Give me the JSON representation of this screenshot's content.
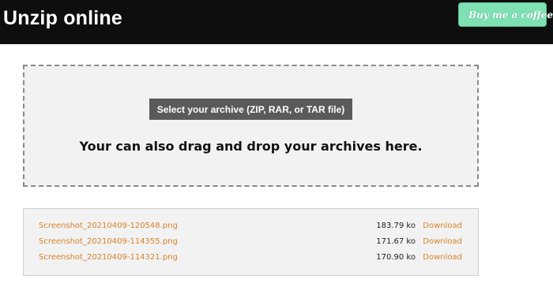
{
  "header": {
    "title": "Unzip online",
    "coffee_button": {
      "label": "Buy me a coffee",
      "icon": "coffee-cup-icon",
      "color": "#7ee0b3"
    }
  },
  "dropzone": {
    "select_button_label": "Select your archive (ZIP, RAR, or TAR file)",
    "hint": "Your can also drag and drop your archives here."
  },
  "files": [
    {
      "name": "Screenshot_20210409-120548.png",
      "size": "183.79 ko",
      "action": "Download"
    },
    {
      "name": "Screenshot_20210409-114355.png",
      "size": "171.67 ko",
      "action": "Download"
    },
    {
      "name": "Screenshot_20210409-114321.png",
      "size": "170.90 ko",
      "action": "Download"
    }
  ],
  "colors": {
    "header_bg": "#0e0e0e",
    "link": "#d9822b",
    "button_bg": "#5a5a5a"
  }
}
